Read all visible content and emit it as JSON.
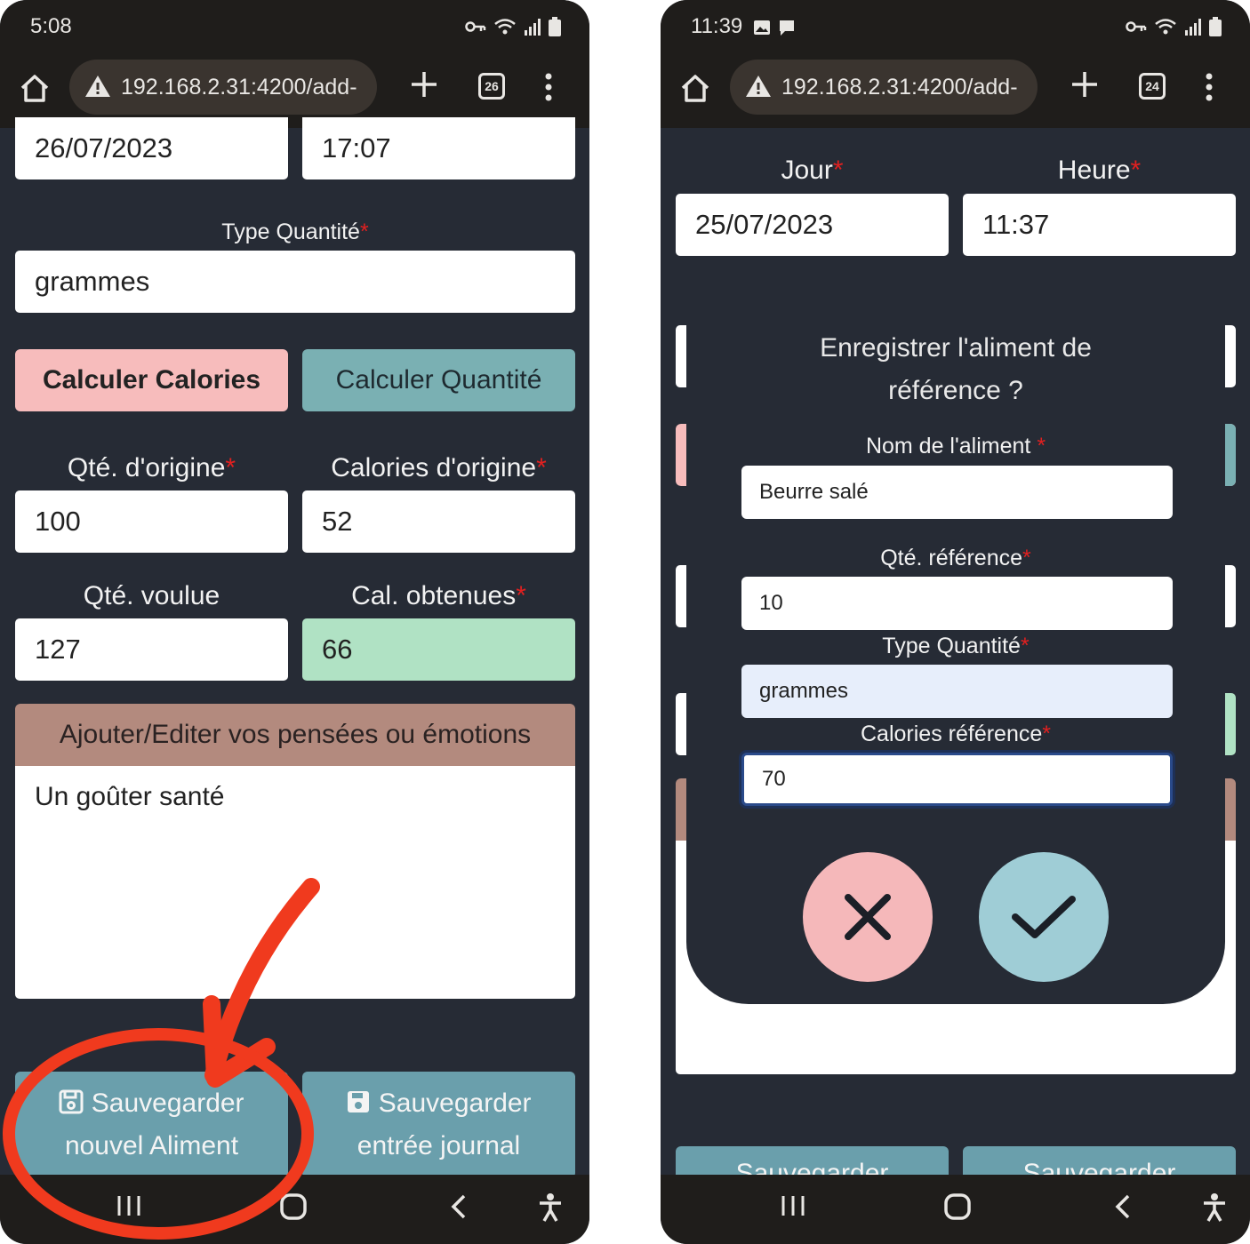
{
  "left": {
    "status": {
      "time": "5:08"
    },
    "browser": {
      "url": "192.168.2.31:4200/add-",
      "tab_count": "26"
    },
    "form": {
      "date_value": "26/07/2023",
      "time_value": "17:07",
      "type_label": "Type Quantité",
      "type_value": "grammes",
      "calc_calories_button": "Calculer Calories",
      "calc_quantity_button": "Calculer Quantité",
      "orig_qty_label": "Qté. d'origine",
      "orig_cal_label": "Calories d'origine",
      "orig_qty_value": "100",
      "orig_cal_value": "52",
      "wanted_qty_label": "Qté. voulue",
      "obtained_cal_label": "Cal. obtenues",
      "wanted_qty_value": "127",
      "obtained_cal_value": "66",
      "thoughts_header": "Ajouter/Editer vos pensées ou émotions",
      "thoughts_value": "Un goûter santé",
      "save_food_line1": "Sauvegarder",
      "save_food_line2": "nouvel Aliment",
      "save_journal_line1": "Sauvegarder",
      "save_journal_line2": "entrée journal",
      "required_marker": "*"
    }
  },
  "right": {
    "status": {
      "time": "11:39"
    },
    "browser": {
      "url": "192.168.2.31:4200/add-",
      "tab_count": "24"
    },
    "form": {
      "day_label": "Jour",
      "hour_label": "Heure",
      "date_value": "25/07/2023",
      "time_value": "11:37",
      "required_marker": "*"
    },
    "modal": {
      "title_line1": "Enregistrer l'aliment de",
      "title_line2": "référence ?",
      "name_label": "Nom de l'aliment",
      "name_value": "Beurre salé",
      "qty_label": "Qté. référence",
      "qty_value": "10",
      "type_label": "Type Quantité",
      "type_value": "grammes",
      "cal_label": "Calories référence",
      "cal_value": "70"
    },
    "bottom": {
      "save_partial_left": "Sauvegarder",
      "save_partial_right": "Sauvegarder"
    }
  },
  "colors": {
    "background": "#262b35",
    "browser_chrome": "#1f1d1b",
    "pink_button": "#f7bcbc",
    "teal_button": "#7ab0b3",
    "save_button": "#6a9fac",
    "green_field": "#b0e2c4",
    "brown_header": "#b38a7e",
    "cancel_circle": "#f5b8ba",
    "confirm_circle": "#9fcdd6",
    "annotation_red": "#f03a1e"
  }
}
